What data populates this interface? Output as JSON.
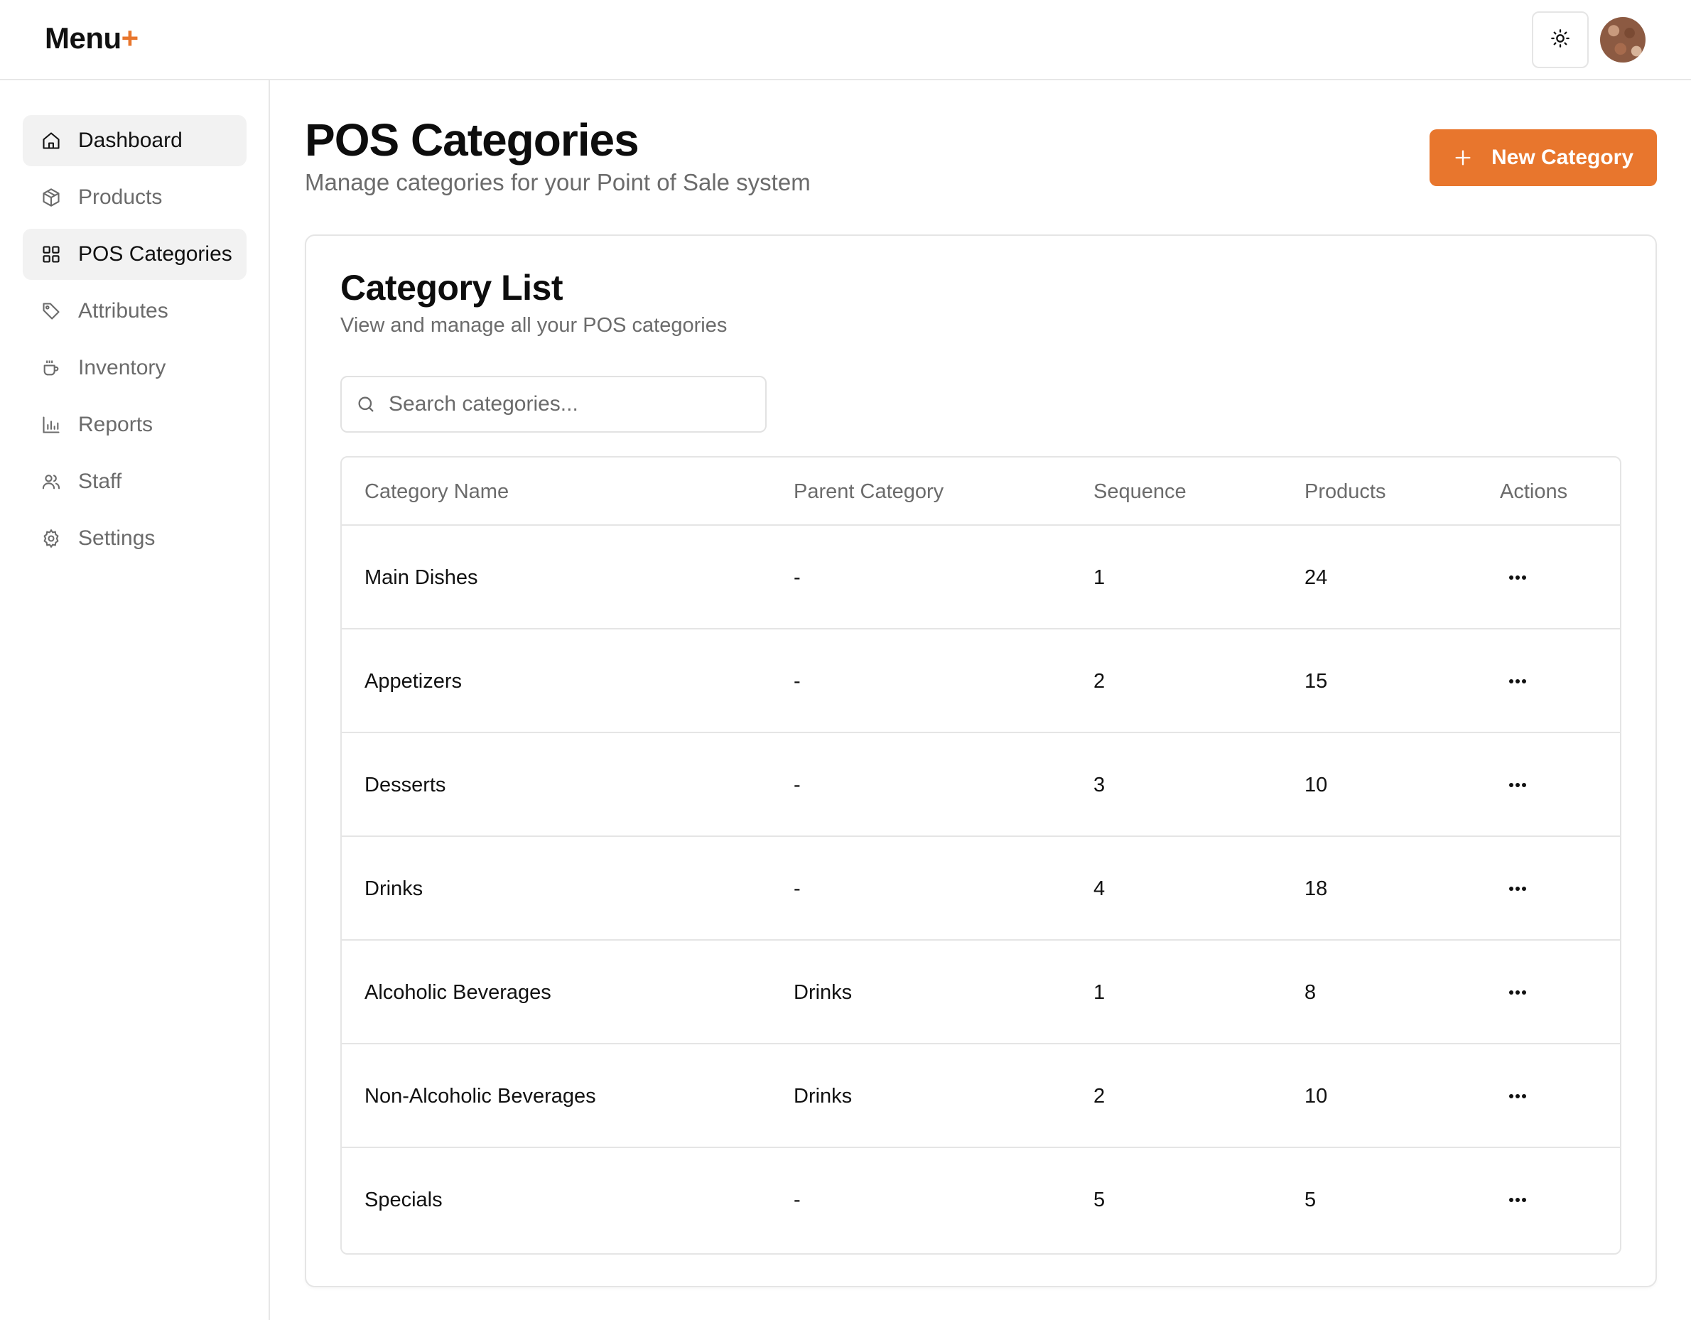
{
  "app": {
    "logo_text": "Menu",
    "logo_plus": "+"
  },
  "header": {
    "theme_icon": "sun-icon",
    "avatar_icon": "user-avatar"
  },
  "sidebar": {
    "items": [
      {
        "label": "Dashboard",
        "icon": "home-icon",
        "active": true
      },
      {
        "label": "Products",
        "icon": "box-icon",
        "active": false
      },
      {
        "label": "POS Categories",
        "icon": "grid-icon",
        "active": true
      },
      {
        "label": "Attributes",
        "icon": "tag-icon",
        "active": false
      },
      {
        "label": "Inventory",
        "icon": "cup-icon",
        "active": false
      },
      {
        "label": "Reports",
        "icon": "bar-chart-icon",
        "active": false
      },
      {
        "label": "Staff",
        "icon": "users-icon",
        "active": false
      },
      {
        "label": "Settings",
        "icon": "gear-icon",
        "active": false
      }
    ]
  },
  "main": {
    "title": "POS Categories",
    "subtitle": "Manage categories for your Point of Sale system",
    "new_button_label": "New Category",
    "card": {
      "title": "Category List",
      "subtitle": "View and manage all your POS categories",
      "search_placeholder": "Search categories...",
      "search_value": ""
    },
    "table": {
      "headers": [
        "Category Name",
        "Parent Category",
        "Sequence",
        "Products",
        "Actions"
      ],
      "rows": [
        {
          "name": "Main Dishes",
          "parent": "-",
          "sequence": "1",
          "products": "24"
        },
        {
          "name": "Appetizers",
          "parent": "-",
          "sequence": "2",
          "products": "15"
        },
        {
          "name": "Desserts",
          "parent": "-",
          "sequence": "3",
          "products": "10"
        },
        {
          "name": "Drinks",
          "parent": "-",
          "sequence": "4",
          "products": "18"
        },
        {
          "name": "Alcoholic Beverages",
          "parent": "Drinks",
          "sequence": "1",
          "products": "8"
        },
        {
          "name": "Non-Alcoholic Beverages",
          "parent": "Drinks",
          "sequence": "2",
          "products": "10"
        },
        {
          "name": "Specials",
          "parent": "-",
          "sequence": "5",
          "products": "5"
        }
      ]
    }
  },
  "colors": {
    "accent": "#e8762d",
    "text_primary": "#111111",
    "text_muted": "#6b6b6b",
    "border": "#e5e5e5",
    "active_bg": "#f2f2f2"
  }
}
